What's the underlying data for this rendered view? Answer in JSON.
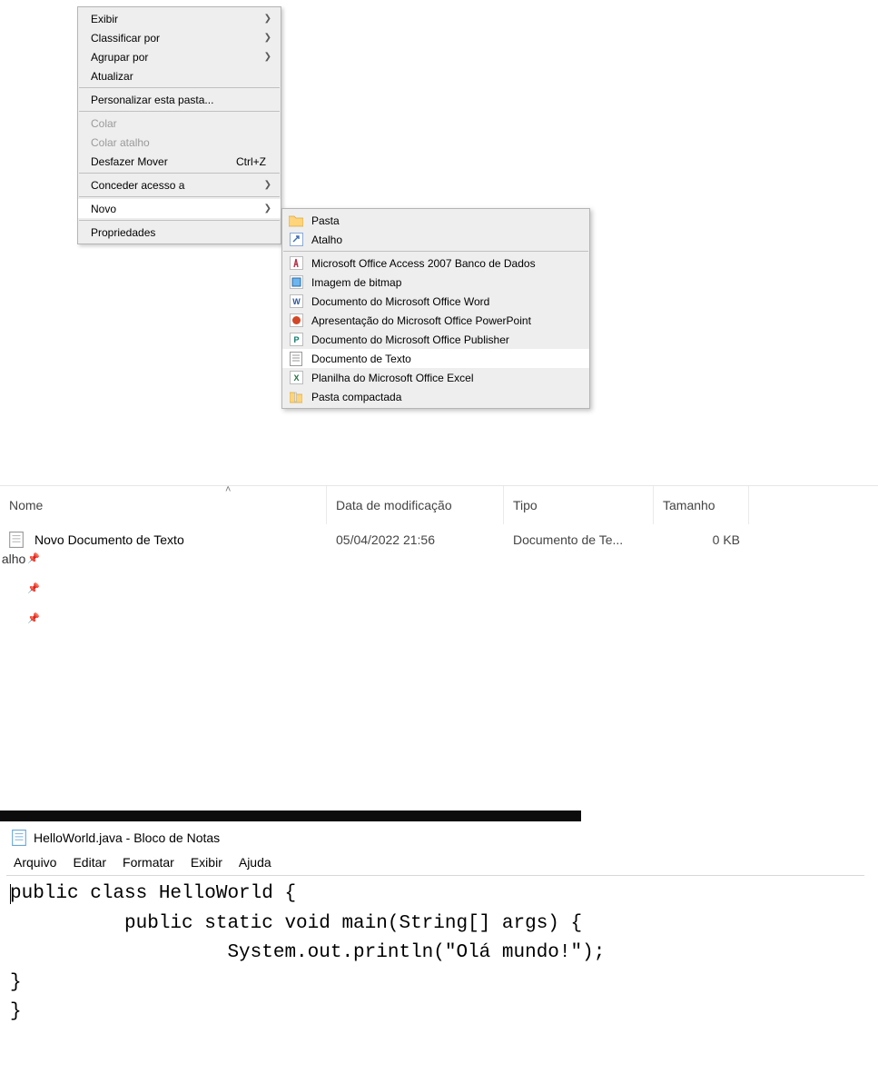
{
  "context_menu": {
    "items": [
      {
        "label": "Exibir",
        "arrow": true
      },
      {
        "label": "Classificar por",
        "arrow": true
      },
      {
        "label": "Agrupar por",
        "arrow": true
      },
      {
        "label": "Atualizar"
      }
    ],
    "personalize": {
      "label": "Personalizar esta pasta..."
    },
    "paste": {
      "label": "Colar",
      "disabled": true
    },
    "paste_shortcut": {
      "label": "Colar atalho",
      "disabled": true
    },
    "undo": {
      "label": "Desfazer Mover",
      "shortcut": "Ctrl+Z"
    },
    "grant_access": {
      "label": "Conceder acesso a",
      "arrow": true
    },
    "new": {
      "label": "Novo",
      "arrow": true
    },
    "properties": {
      "label": "Propriedades"
    }
  },
  "submenu": {
    "folder": "Pasta",
    "shortcut": "Atalho",
    "access": "Microsoft Office Access 2007 Banco de Dados",
    "bitmap": "Imagem de bitmap",
    "word": "Documento do Microsoft Office Word",
    "ppt": "Apresentação do Microsoft Office PowerPoint",
    "publisher": "Documento do Microsoft Office Publisher",
    "txt": "Documento de Texto",
    "excel": "Planilha do Microsoft Office Excel",
    "zip": "Pasta compactada"
  },
  "explorer": {
    "columns": {
      "name": "Nome",
      "date": "Data de modificação",
      "type": "Tipo",
      "size": "Tamanho"
    },
    "row": {
      "name": "Novo Documento de Texto",
      "date": "05/04/2022 21:56",
      "type": "Documento de Te...",
      "size": "0 KB"
    },
    "pins": {
      "item1": "alho"
    }
  },
  "notepad": {
    "title": "HelloWorld.java - Bloco de Notas",
    "menu": {
      "file": "Arquivo",
      "edit": "Editar",
      "format": "Formatar",
      "view": "Exibir",
      "help": "Ajuda"
    },
    "code": "public class HelloWorld {\n          public static void main(String[] args) {\n                   System.out.println(\"Olá mundo!\");\n}\n}"
  }
}
